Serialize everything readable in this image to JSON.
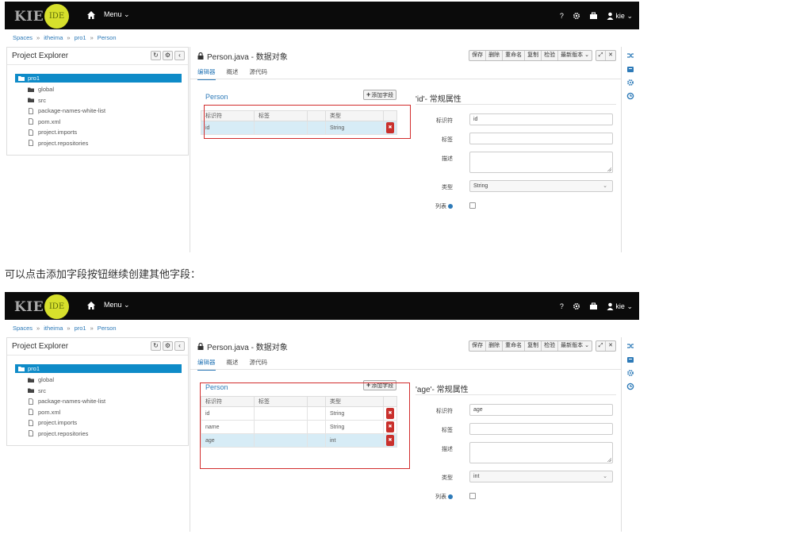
{
  "caption": "可以点击添加字段按钮继续创建其他字段：",
  "shots": [
    {
      "header": {
        "logo": "KIE",
        "ide": "IDE",
        "menu": "Menu",
        "help": "?",
        "user": "kie"
      },
      "breadcrumb": [
        "Spaces",
        "itheima",
        "pro1",
        "Person"
      ],
      "explorer": {
        "title": "Project Explorer",
        "root": "pro1",
        "items": [
          {
            "label": "global",
            "icon": "folder-icon"
          },
          {
            "label": "src",
            "icon": "folder-icon"
          },
          {
            "label": "package-names-white-list",
            "icon": "file-icon"
          },
          {
            "label": "pom.xml",
            "icon": "file-icon"
          },
          {
            "label": "project.imports",
            "icon": "file-icon"
          },
          {
            "label": "project.repositories",
            "icon": "file-icon"
          }
        ]
      },
      "editor": {
        "title": "Person.java - 数据对象",
        "toolbar": [
          "保存",
          "删除",
          "重命名",
          "复制",
          "检验",
          "最新版本"
        ],
        "tabs": [
          "编辑器",
          "概述",
          "源代码"
        ],
        "object_name": "Person",
        "add_field": "添加字段",
        "columns": [
          "标识符",
          "标签",
          "类型"
        ],
        "rows": [
          {
            "id": "id",
            "label": "",
            "type": "String",
            "selected": true
          }
        ]
      },
      "props": {
        "title": "'id'- 常规属性",
        "identifier_label": "标识符",
        "identifier_value": "id",
        "label_label": "标签",
        "label_value": "",
        "desc_label": "描述",
        "type_label": "类型",
        "type_value": "String",
        "list_label": "列表"
      }
    },
    {
      "header": {
        "logo": "KIE",
        "ide": "IDE",
        "menu": "Menu",
        "help": "?",
        "user": "kie"
      },
      "breadcrumb": [
        "Spaces",
        "itheima",
        "pro1",
        "Person"
      ],
      "explorer": {
        "title": "Project Explorer",
        "root": "pro1",
        "items": [
          {
            "label": "global",
            "icon": "folder-icon"
          },
          {
            "label": "src",
            "icon": "folder-icon"
          },
          {
            "label": "package-names-white-list",
            "icon": "file-icon"
          },
          {
            "label": "pom.xml",
            "icon": "file-icon"
          },
          {
            "label": "project.imports",
            "icon": "file-icon"
          },
          {
            "label": "project.repositories",
            "icon": "file-icon"
          }
        ]
      },
      "editor": {
        "title": "Person.java - 数据对象",
        "toolbar": [
          "保存",
          "删除",
          "重命名",
          "复制",
          "检验",
          "最新版本"
        ],
        "tabs": [
          "编辑器",
          "概述",
          "源代码"
        ],
        "object_name": "Person",
        "add_field": "添加字段",
        "columns": [
          "标识符",
          "标签",
          "类型"
        ],
        "rows": [
          {
            "id": "id",
            "label": "",
            "type": "String",
            "selected": false
          },
          {
            "id": "name",
            "label": "",
            "type": "String",
            "selected": false
          },
          {
            "id": "age",
            "label": "",
            "type": "int",
            "selected": true
          }
        ]
      },
      "props": {
        "title": "'age'- 常规属性",
        "identifier_label": "标识符",
        "identifier_value": "age",
        "label_label": "标签",
        "label_value": "",
        "desc_label": "描述",
        "type_label": "类型",
        "type_value": "int",
        "list_label": "列表"
      }
    }
  ],
  "colors": {
    "accent": "#2d7ab8",
    "tree_selected": "#0e8bc8",
    "highlight_box": "#d22d2d",
    "delete": "#c9302c",
    "topbar": "#0b0b0b",
    "ide_badge": "#d7e02c"
  }
}
